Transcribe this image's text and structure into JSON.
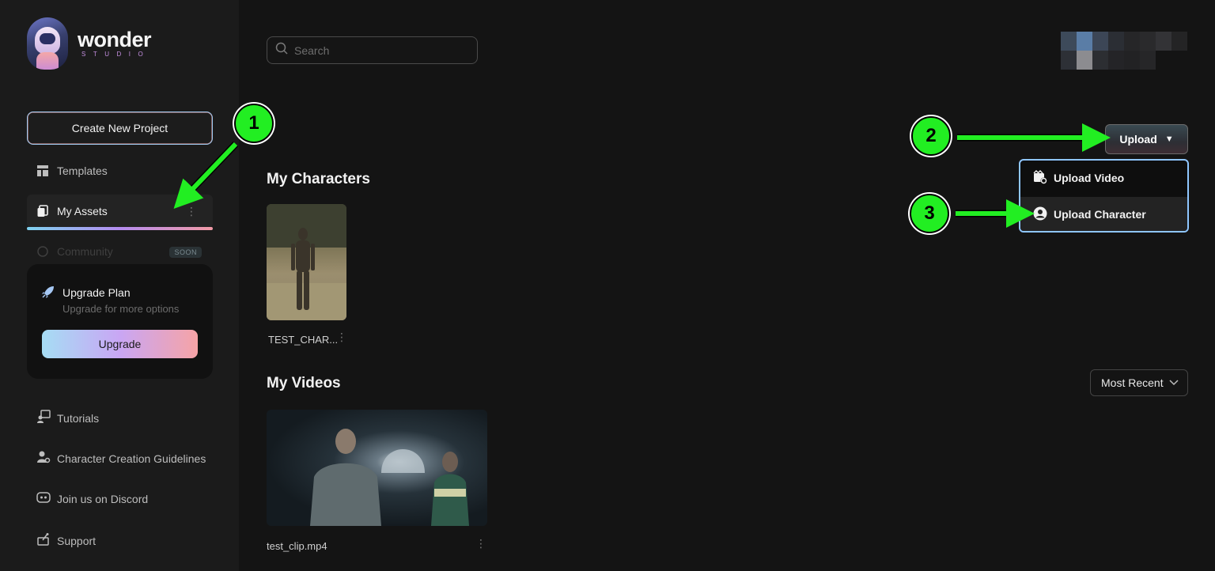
{
  "brand": {
    "name": "wonder",
    "sub": "STUDIO"
  },
  "sidebar": {
    "create_button": "Create New Project",
    "items": [
      {
        "label": "Templates"
      },
      {
        "label": "My Assets"
      },
      {
        "label": "Community",
        "badge": "SOON"
      }
    ],
    "upgrade": {
      "title": "Upgrade Plan",
      "subtitle": "Upgrade for more options",
      "button": "Upgrade"
    },
    "bottom_items": [
      {
        "label": "Tutorials"
      },
      {
        "label": "Character Creation Guidelines"
      },
      {
        "label": "Join us on Discord"
      },
      {
        "label": "Support"
      }
    ]
  },
  "search": {
    "placeholder": "Search",
    "value": ""
  },
  "upload": {
    "button_label": "Upload",
    "menu": [
      {
        "label": "Upload Video"
      },
      {
        "label": "Upload Character"
      }
    ]
  },
  "sections": {
    "characters": {
      "title": "My Characters",
      "items": [
        {
          "name": "TEST_CHAR..."
        }
      ]
    },
    "videos": {
      "title": "My Videos",
      "sort": "Most Recent",
      "items": [
        {
          "name": "test_clip.mp4"
        }
      ]
    }
  },
  "annotations": {
    "steps": [
      "1",
      "2",
      "3"
    ]
  },
  "colors": {
    "background": "#141414",
    "sidebar": "#1b1b1b",
    "accent_gradient": [
      "#a6ddf4",
      "#c9a6f4",
      "#f6a3a6"
    ],
    "annotation_green": "#22ee22"
  }
}
